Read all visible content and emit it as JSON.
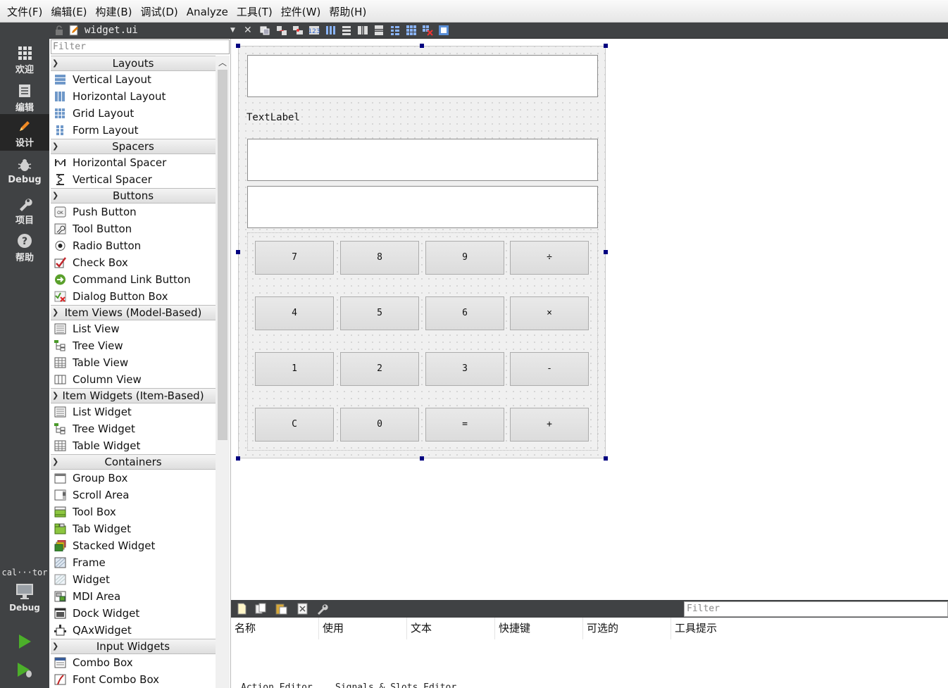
{
  "menu": [
    "文件(F)",
    "编辑(E)",
    "构建(B)",
    "调试(D)",
    "Analyze",
    "工具(T)",
    "控件(W)",
    "帮助(H)"
  ],
  "modes": [
    {
      "label": "欢迎",
      "icon": "grid-icon"
    },
    {
      "label": "编辑",
      "icon": "document-icon"
    },
    {
      "label": "设计",
      "icon": "pencil-icon",
      "active": true
    },
    {
      "label": "Debug",
      "icon": "bug-icon"
    },
    {
      "label": "项目",
      "icon": "wrench-icon"
    },
    {
      "label": "帮助",
      "icon": "help-icon"
    }
  ],
  "project_name": "cal···tor",
  "kit_label": "Debug",
  "editor": {
    "file_name": "widget.ui"
  },
  "widgetbox": {
    "filter_placeholder": "Filter",
    "categories": [
      {
        "name": "Layouts",
        "items": [
          {
            "label": "Vertical Layout",
            "icon": "vertical-layout-icon"
          },
          {
            "label": "Horizontal Layout",
            "icon": "horizontal-layout-icon"
          },
          {
            "label": "Grid Layout",
            "icon": "grid-layout-icon"
          },
          {
            "label": "Form Layout",
            "icon": "form-layout-icon"
          }
        ]
      },
      {
        "name": "Spacers",
        "items": [
          {
            "label": "Horizontal Spacer",
            "icon": "horizontal-spacer-icon"
          },
          {
            "label": "Vertical Spacer",
            "icon": "vertical-spacer-icon"
          }
        ]
      },
      {
        "name": "Buttons",
        "items": [
          {
            "label": "Push Button",
            "icon": "push-button-icon"
          },
          {
            "label": "Tool Button",
            "icon": "tool-button-icon"
          },
          {
            "label": "Radio Button",
            "icon": "radio-button-icon"
          },
          {
            "label": "Check Box",
            "icon": "check-box-icon"
          },
          {
            "label": "Command Link Button",
            "icon": "command-link-icon"
          },
          {
            "label": "Dialog Button Box",
            "icon": "dialog-button-box-icon"
          }
        ]
      },
      {
        "name": "Item Views (Model-Based)",
        "items": [
          {
            "label": "List View",
            "icon": "list-view-icon"
          },
          {
            "label": "Tree View",
            "icon": "tree-view-icon"
          },
          {
            "label": "Table View",
            "icon": "table-view-icon"
          },
          {
            "label": "Column View",
            "icon": "column-view-icon"
          }
        ]
      },
      {
        "name": "Item Widgets (Item-Based)",
        "items": [
          {
            "label": "List Widget",
            "icon": "list-widget-icon"
          },
          {
            "label": "Tree Widget",
            "icon": "tree-widget-icon"
          },
          {
            "label": "Table Widget",
            "icon": "table-widget-icon"
          }
        ]
      },
      {
        "name": "Containers",
        "items": [
          {
            "label": "Group Box",
            "icon": "group-box-icon"
          },
          {
            "label": "Scroll Area",
            "icon": "scroll-area-icon"
          },
          {
            "label": "Tool Box",
            "icon": "tool-box-icon"
          },
          {
            "label": "Tab Widget",
            "icon": "tab-widget-icon"
          },
          {
            "label": "Stacked Widget",
            "icon": "stacked-widget-icon"
          },
          {
            "label": "Frame",
            "icon": "frame-icon"
          },
          {
            "label": "Widget",
            "icon": "widget-icon"
          },
          {
            "label": "MDI Area",
            "icon": "mdi-area-icon"
          },
          {
            "label": "Dock Widget",
            "icon": "dock-widget-icon"
          },
          {
            "label": "QAxWidget",
            "icon": "qaxwidget-icon"
          }
        ]
      },
      {
        "name": "Input Widgets",
        "items": [
          {
            "label": "Combo Box",
            "icon": "combo-box-icon"
          },
          {
            "label": "Font Combo Box",
            "icon": "font-combo-box-icon"
          }
        ]
      }
    ]
  },
  "form": {
    "text_label": "TextLabel",
    "buttons": [
      [
        "7",
        "8",
        "9",
        "÷"
      ],
      [
        "4",
        "5",
        "6",
        "×"
      ],
      [
        "1",
        "2",
        "3",
        "-"
      ],
      [
        "C",
        "0",
        "=",
        "+"
      ]
    ]
  },
  "action_editor": {
    "filter_placeholder": "Filter",
    "columns": [
      "名称",
      "使用",
      "文本",
      "快捷键",
      "可选的",
      "工具提示"
    ],
    "tabs": [
      "Action Editor",
      "Signals & Slots Editor"
    ]
  },
  "colors": {
    "sidebar": "#404244",
    "active_mode": "#262626",
    "selection_handle": "#000080",
    "form_bg": "#f0f0f0"
  }
}
